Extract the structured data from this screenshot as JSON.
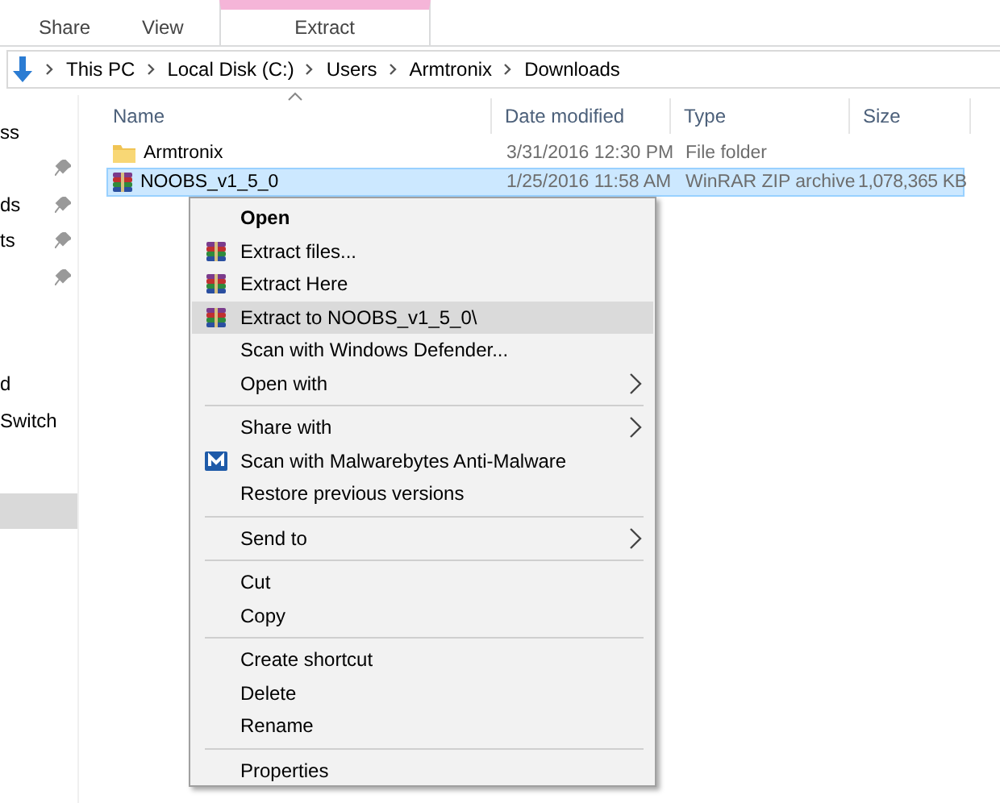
{
  "ribbon": {
    "tabs": [
      {
        "label": "Share",
        "selected": false
      },
      {
        "label": "View",
        "selected": false
      },
      {
        "label": "Extract",
        "selected": true
      }
    ]
  },
  "address": {
    "crumbs": [
      "This PC",
      "Local Disk (C:)",
      "Users",
      "Armtronix",
      "Downloads"
    ]
  },
  "nav": {
    "groups": [
      [
        {
          "label": "ss",
          "pinned": false,
          "selected": false
        },
        {
          "pinned": true,
          "selected": false
        },
        {
          "label": "ds",
          "pinned": true,
          "selected": false
        },
        {
          "label": "ts",
          "pinned": true,
          "selected": false
        },
        {
          "pinned": true,
          "selected": false
        }
      ],
      [
        {
          "label": "d",
          "pinned": false,
          "selected": false
        },
        {
          "label": "Switch",
          "pinned": false,
          "selected": false
        }
      ],
      [
        {
          "pinned": false,
          "selected": true
        }
      ]
    ]
  },
  "files": {
    "columns": [
      "Name",
      "Date modified",
      "Type",
      "Size"
    ],
    "rows": [
      {
        "kind": "folder",
        "name": "Armtronix",
        "date": "3/31/2016 12:30 PM",
        "type": "File folder",
        "selected": false
      },
      {
        "kind": "archive",
        "name": "NOOBS_v1_5_0",
        "date": "1/25/2016 11:58 AM",
        "type": "WinRAR ZIP archive",
        "size": "1,078,365 KB",
        "selected": true
      }
    ]
  },
  "context_menu": {
    "groups": [
      [
        {
          "label": "Open",
          "default": true,
          "selected": false,
          "submenu": false
        },
        {
          "label": "Extract files...",
          "kind": "archive",
          "default": false,
          "selected": false,
          "submenu": false
        },
        {
          "label": "Extract Here",
          "kind": "archive",
          "default": false,
          "selected": false,
          "submenu": false
        },
        {
          "label": "Extract to NOOBS_v1_5_0\\",
          "kind": "archive",
          "default": false,
          "selected": true,
          "submenu": false
        },
        {
          "label": "Scan with Windows Defender...",
          "default": false,
          "selected": false,
          "submenu": false
        },
        {
          "label": "Open with",
          "default": false,
          "selected": false,
          "submenu": true
        }
      ],
      [
        {
          "label": "Share with",
          "default": false,
          "selected": false,
          "submenu": true
        },
        {
          "label": "Scan with Malwarebytes Anti-Malware",
          "kind": "scanner",
          "default": false,
          "selected": false,
          "submenu": false
        },
        {
          "label": "Restore previous versions",
          "default": false,
          "selected": false,
          "submenu": false
        }
      ],
      [
        {
          "label": "Send to",
          "default": false,
          "selected": false,
          "submenu": true
        }
      ],
      [
        {
          "label": "Cut",
          "default": false,
          "selected": false,
          "submenu": false
        },
        {
          "label": "Copy",
          "default": false,
          "selected": false,
          "submenu": false
        }
      ],
      [
        {
          "label": "Create shortcut",
          "default": false,
          "selected": false,
          "submenu": false
        },
        {
          "label": "Delete",
          "default": false,
          "selected": false,
          "submenu": false
        },
        {
          "label": "Rename",
          "default": false,
          "selected": false,
          "submenu": false
        }
      ],
      [
        {
          "label": "Properties",
          "default": false,
          "selected": false,
          "submenu": false
        }
      ]
    ]
  }
}
